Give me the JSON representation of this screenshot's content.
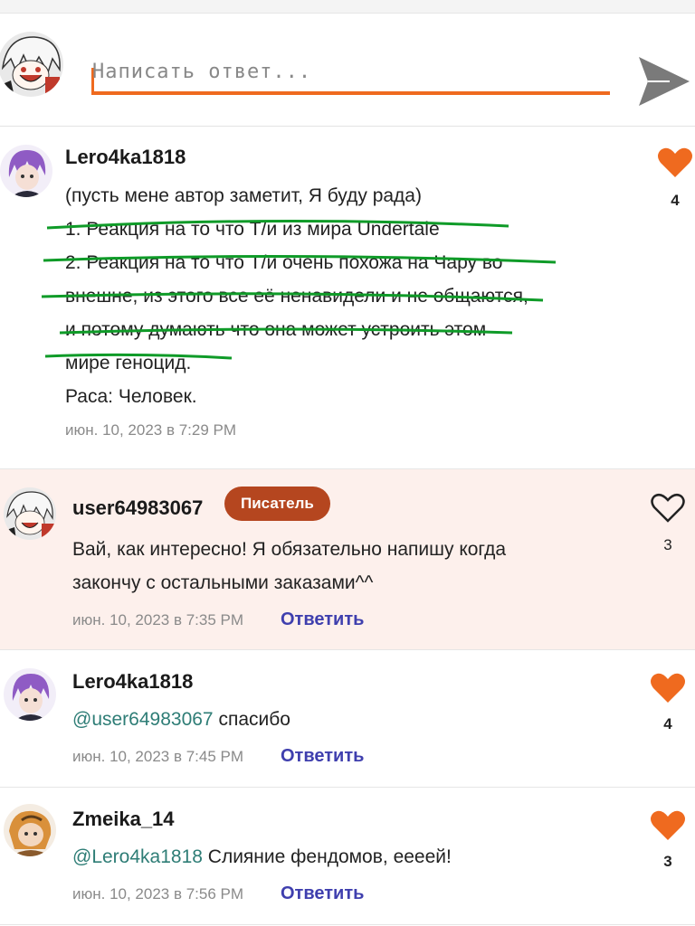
{
  "composer": {
    "placeholder": "Написать ответ...",
    "send_icon": "send-arrow-icon"
  },
  "colors": {
    "accent": "#ef6a1f",
    "link": "#3f3fae",
    "mention": "#2e7d76",
    "badge": "#b5461f",
    "highlight_bg": "#fdf0ec",
    "strike_green": "#0f9b28"
  },
  "comments": [
    {
      "username": "Lero4ka1818",
      "lines": [
        "(пусть мене автор заметит, Я буду рада)",
        "1. Реакция на то что Т/и из мира Undertale",
        "2. Реакция на то что Т/и очень похожа на Чару во",
        "внешне, из этого все  её ненавидели и не общаются,",
        "и потому  думають что она может устроить  этом",
        "мире геноцид.",
        "Раса: Человек."
      ],
      "timestamp": "июн. 10, 2023 в 7:29 PM",
      "likes": "4",
      "liked": true
    },
    {
      "username": "user64983067",
      "badge": "Писатель",
      "lines": [
        "Вай, как интересно! Я обязательно напишу когда",
        "закончу с остальными заказами^^"
      ],
      "timestamp": "июн. 10, 2023 в 7:35 PM",
      "reply_label": "Ответить",
      "likes": "3",
      "liked": false
    },
    {
      "username": "Lero4ka1818",
      "mention": "@user64983067",
      "text": " спасибо",
      "timestamp": "июн. 10, 2023 в 7:45 PM",
      "reply_label": "Ответить",
      "likes": "4",
      "liked": true
    },
    {
      "username": "Zmeika_14",
      "mention": "@Lero4ka1818",
      "text": " Слияние фендомов, еееей!",
      "timestamp": "июн. 10, 2023 в 7:56 PM",
      "reply_label": "Ответить",
      "likes": "3",
      "liked": true
    }
  ]
}
